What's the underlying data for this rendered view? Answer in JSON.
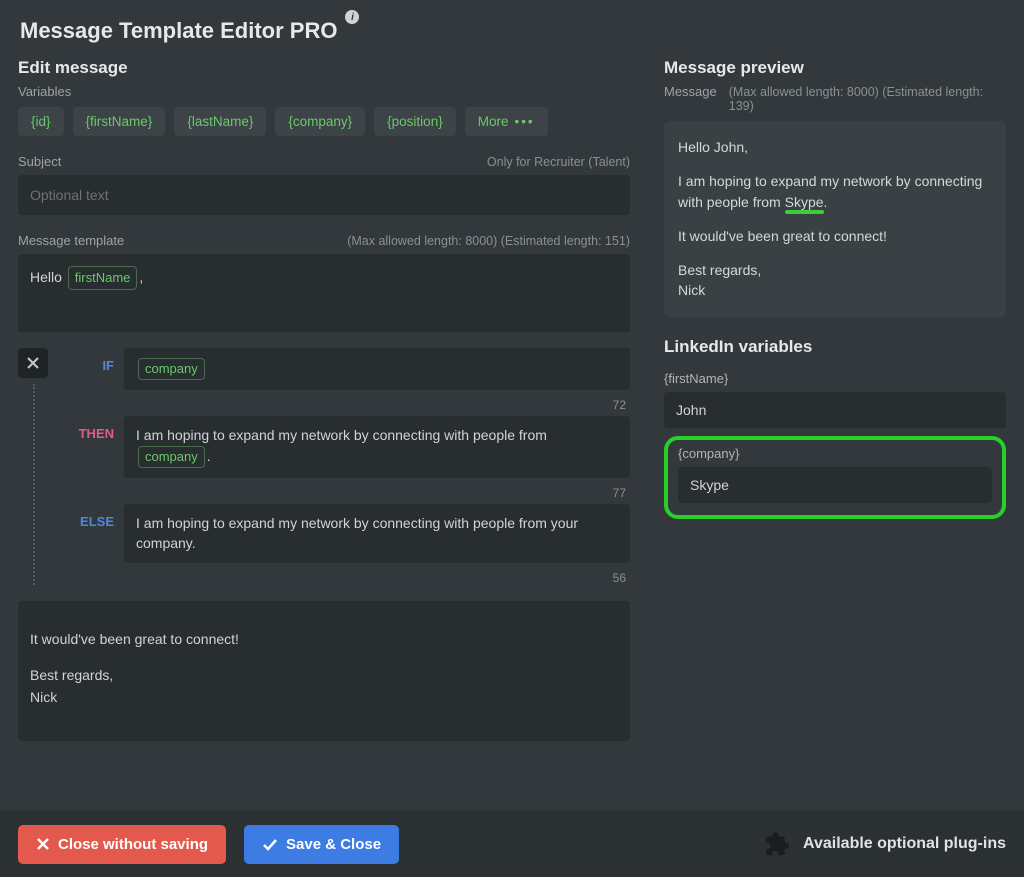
{
  "title": "Message Template Editor PRO",
  "editor": {
    "heading": "Edit message",
    "variables_label": "Variables",
    "chips": [
      "{id}",
      "{firstName}",
      "{lastName}",
      "{company}",
      "{position}"
    ],
    "more_label": "More",
    "subject_label": "Subject",
    "subject_hint": "Only for Recruiter (Talent)",
    "subject_placeholder": "Optional text",
    "template_label": "Message template",
    "template_hint": "(Max allowed length: 8000) (Estimated length: 151)",
    "template_intro_prefix": "Hello ",
    "template_intro_var": "firstName",
    "template_intro_suffix": ",",
    "logic": {
      "if_label": "IF",
      "then_label": "THEN",
      "else_label": "ELSE",
      "if_var": "company",
      "if_count": "72",
      "then_prefix": "I am hoping to expand my network by connecting with people from ",
      "then_var": "company",
      "then_suffix": ".",
      "then_count": "77",
      "else_text": "I am hoping to expand my network by connecting with people from your company.",
      "else_count": "56"
    },
    "after_text_1": "It would've been great to connect!",
    "after_text_2": "Best regards,",
    "after_text_3": "Nick"
  },
  "preview": {
    "heading": "Message preview",
    "label": "Message",
    "hint": "(Max allowed length: 8000) (Estimated length: 139)",
    "p1": "Hello John,",
    "p2_pre": "I am hoping to expand my network by connecting with people from ",
    "p2_hl": "Skype",
    "p2_post": ".",
    "p3": "It would've been great to connect!",
    "p4a": "Best regards,",
    "p4b": "Nick",
    "linkedin_heading": "LinkedIn variables",
    "vars": {
      "firstName_label": "{firstName}",
      "firstName_value": "John",
      "company_label": "{company}",
      "company_value": "Skype"
    }
  },
  "footer": {
    "close_label": "Close without saving",
    "save_label": "Save & Close",
    "plugins_label": "Available optional plug-ins"
  }
}
